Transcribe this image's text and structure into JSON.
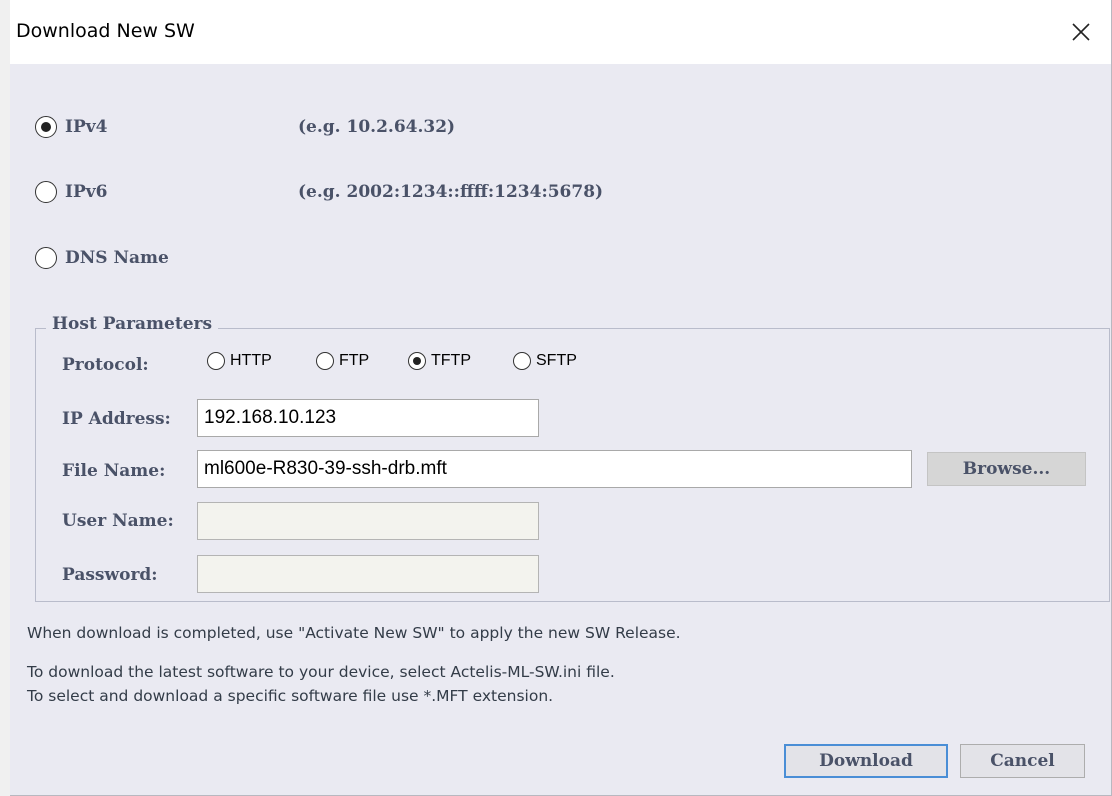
{
  "dialog": {
    "title": "Download New SW",
    "close_icon": "close-icon"
  },
  "address_type": {
    "selected": "IPv4",
    "options": [
      {
        "label": "IPv4",
        "example": "(e.g. 10.2.64.32)",
        "checked": true
      },
      {
        "label": "IPv6",
        "example": "(e.g. 2002:1234::ffff:1234:5678)",
        "checked": false
      },
      {
        "label": "DNS Name",
        "example": "",
        "checked": false
      }
    ]
  },
  "host_parameters": {
    "legend": "Host Parameters",
    "protocol_label": "Protocol:",
    "protocols": [
      {
        "label": "HTTP",
        "checked": false
      },
      {
        "label": "FTP",
        "checked": false
      },
      {
        "label": "TFTP",
        "checked": true
      },
      {
        "label": "SFTP",
        "checked": false
      }
    ],
    "ip_label": "IP Address:",
    "ip_value": "192.168.10.123",
    "file_label": "File Name:",
    "file_value": "ml600e-R830-39-ssh-drb.mft",
    "browse_label": "Browse...",
    "user_label": "User Name:",
    "user_value": "",
    "password_label": "Password:",
    "password_value": ""
  },
  "info": {
    "line1": "When download is completed, use \"Activate New SW\" to apply the new SW Release.",
    "line2": "To download the latest software to your device, select Actelis-ML-SW.ini file.",
    "line3": "To select and download a specific software file use *.MFT extension."
  },
  "buttons": {
    "download": "Download",
    "cancel": "Cancel"
  },
  "colors": {
    "dialog_bg": "#eaeaf2",
    "label_text": "#4a5268",
    "default_button_border": "#4a8ed6"
  }
}
